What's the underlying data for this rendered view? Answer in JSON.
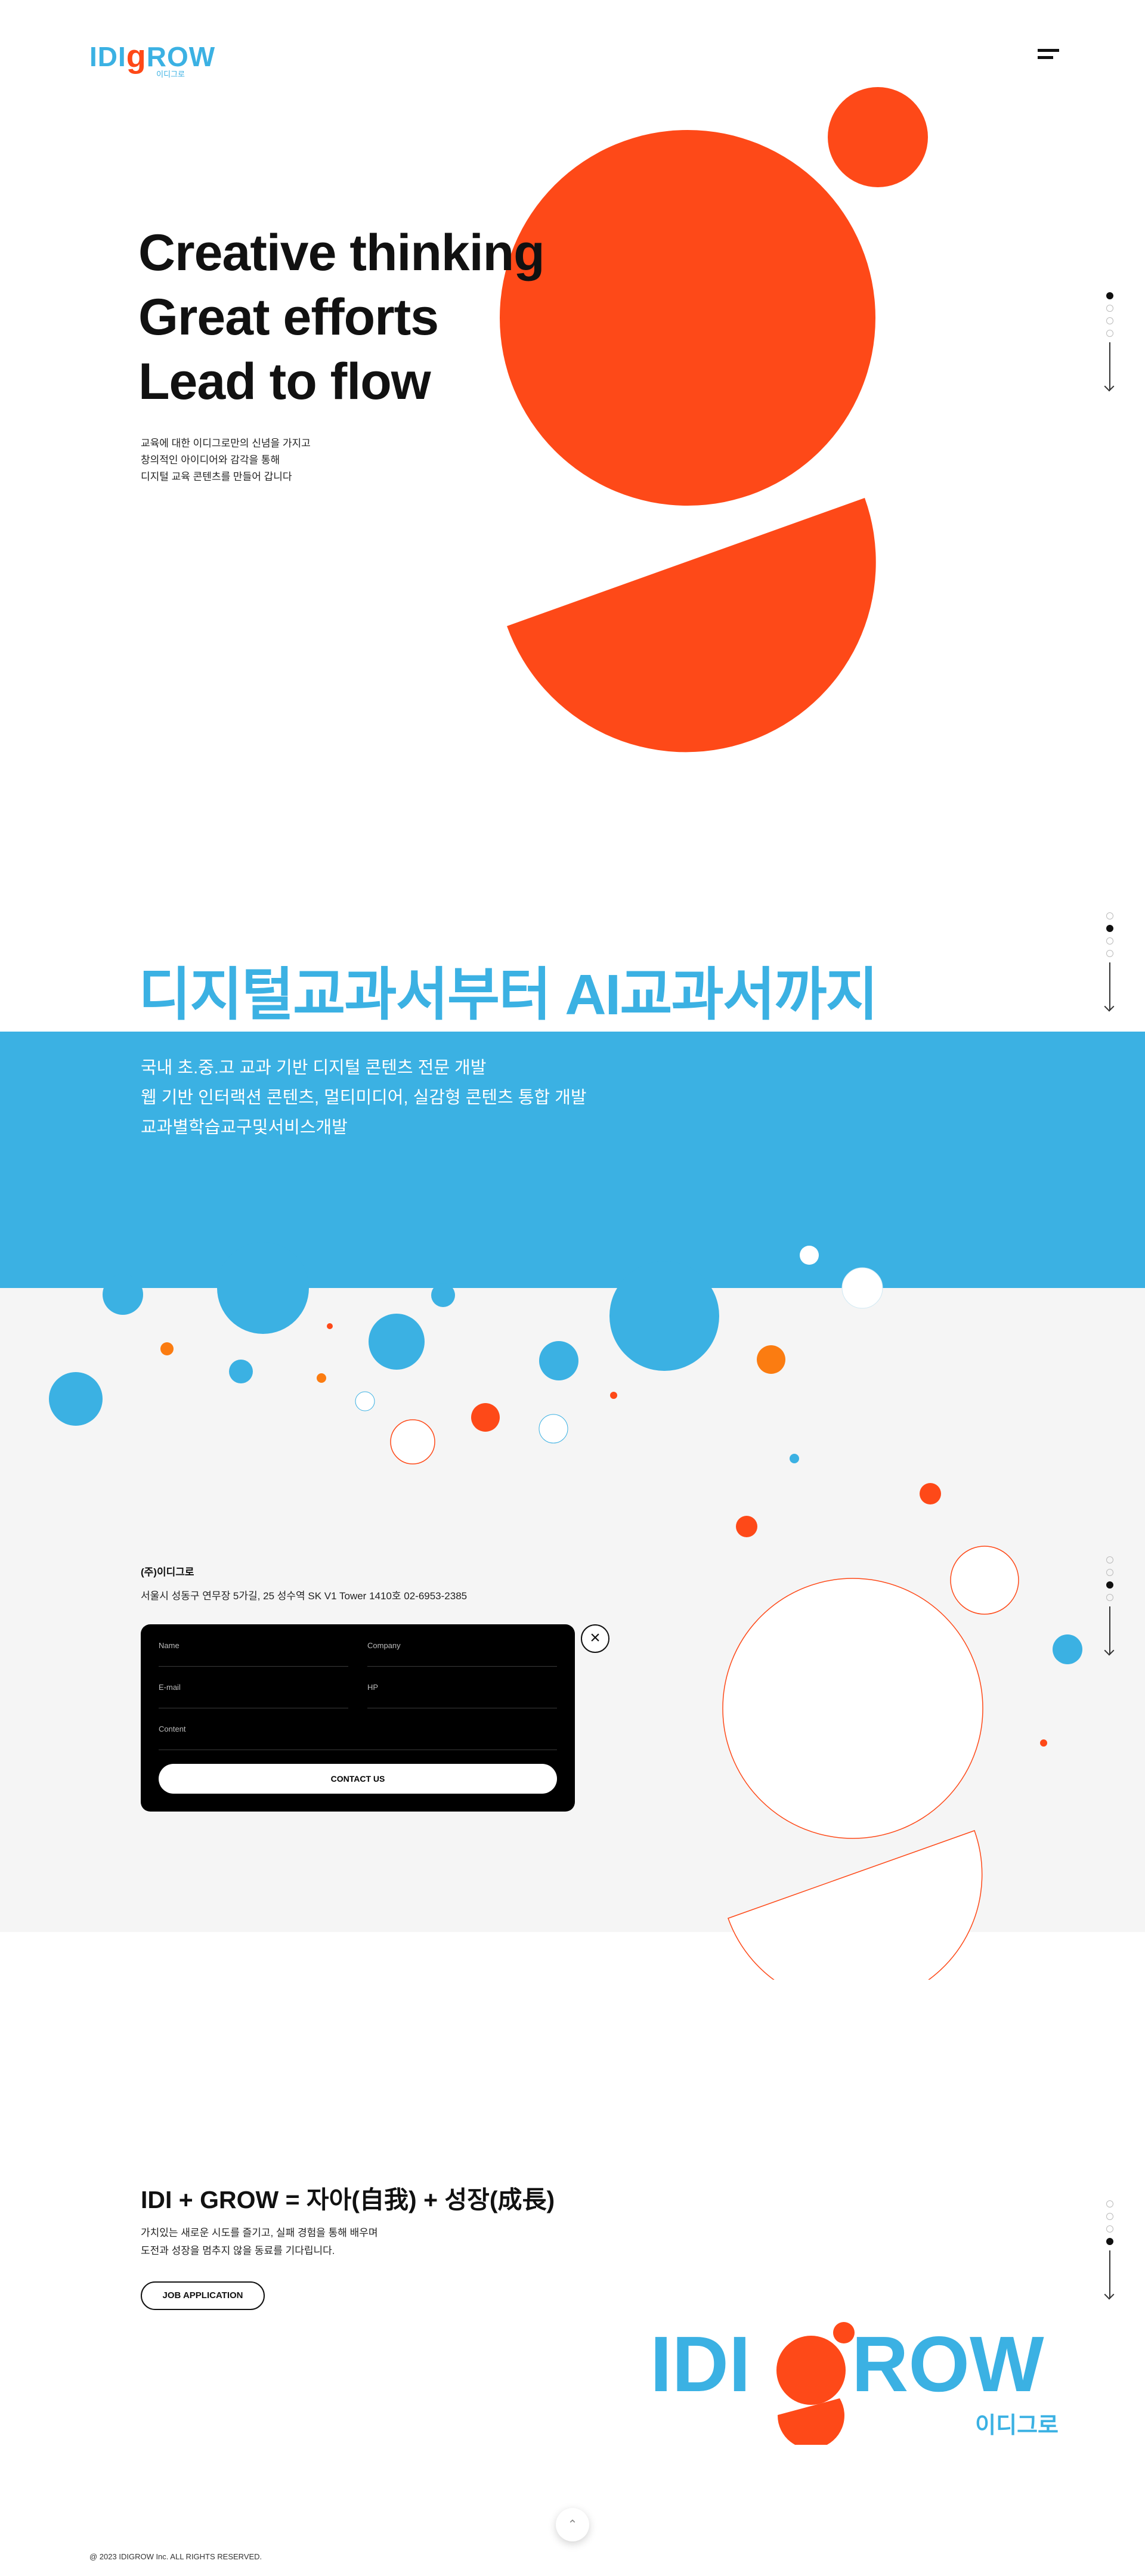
{
  "header": {
    "logo_text_1": "IDI",
    "logo_text_2": "g",
    "logo_text_3": "ROW",
    "logo_sub": "이디그로",
    "menu_icon": "hamburger-icon"
  },
  "hero": {
    "title_lines": [
      "Creative thinking",
      "Great efforts",
      "Lead to flow"
    ],
    "desc_lines": [
      "교육에 대한 이디그로만의 신념을 가지고",
      "창의적인 아이디어와 감각을 통해",
      "디지털 교육 콘텐츠를 만들어 갑니다"
    ]
  },
  "section2": {
    "title": "디지털교과서부터 AI교과서까지",
    "lines": [
      "국내 초.중.고 교과 기반 디지털 콘텐츠 전문 개발",
      "웹 기반 인터랙션 콘텐츠, 멀티미디어, 실감형 콘텐츠 통합 개발",
      "교과별학습교구및서비스개발"
    ]
  },
  "contact": {
    "company": "(주)이디그로",
    "address": "서울시 성동구 연무장 5가길, 25 성수역 SK V1 Tower 1410호 02-6953-2385",
    "fields": {
      "name": "Name",
      "company": "Company",
      "email": "E-mail",
      "hp": "HP",
      "content": "Content"
    },
    "submit": "CONTACT US",
    "close_icon": "close-icon"
  },
  "section4": {
    "title": "IDI + GROW = 자아(自我) + 성장(成長)",
    "desc_lines": [
      "가치있는 새로운 시도를 즐기고, 실패 경험을 통해 배우며",
      "도전과 성장을 멈추지 않을 동료를 기다립니다."
    ],
    "button": "JOB APPLICATION",
    "big_logo_text": "IDIGROW",
    "big_logo_sub": "이디그로"
  },
  "footer": {
    "top_icon": "chevron-up-icon",
    "copyright": "@ 2023 IDIGROW Inc. ALL RIGHTS RESERVED."
  },
  "colors": {
    "brand_blue": "#3bb1e3",
    "brand_orange": "#fe4918",
    "accent_orange": "#fb7c11",
    "grey_bg": "#f5f5f5"
  },
  "pagers": [
    {
      "active": 0,
      "count": 4
    },
    {
      "active": 1,
      "count": 4
    },
    {
      "active": 2,
      "count": 4
    },
    {
      "active": 3,
      "count": 4
    }
  ]
}
